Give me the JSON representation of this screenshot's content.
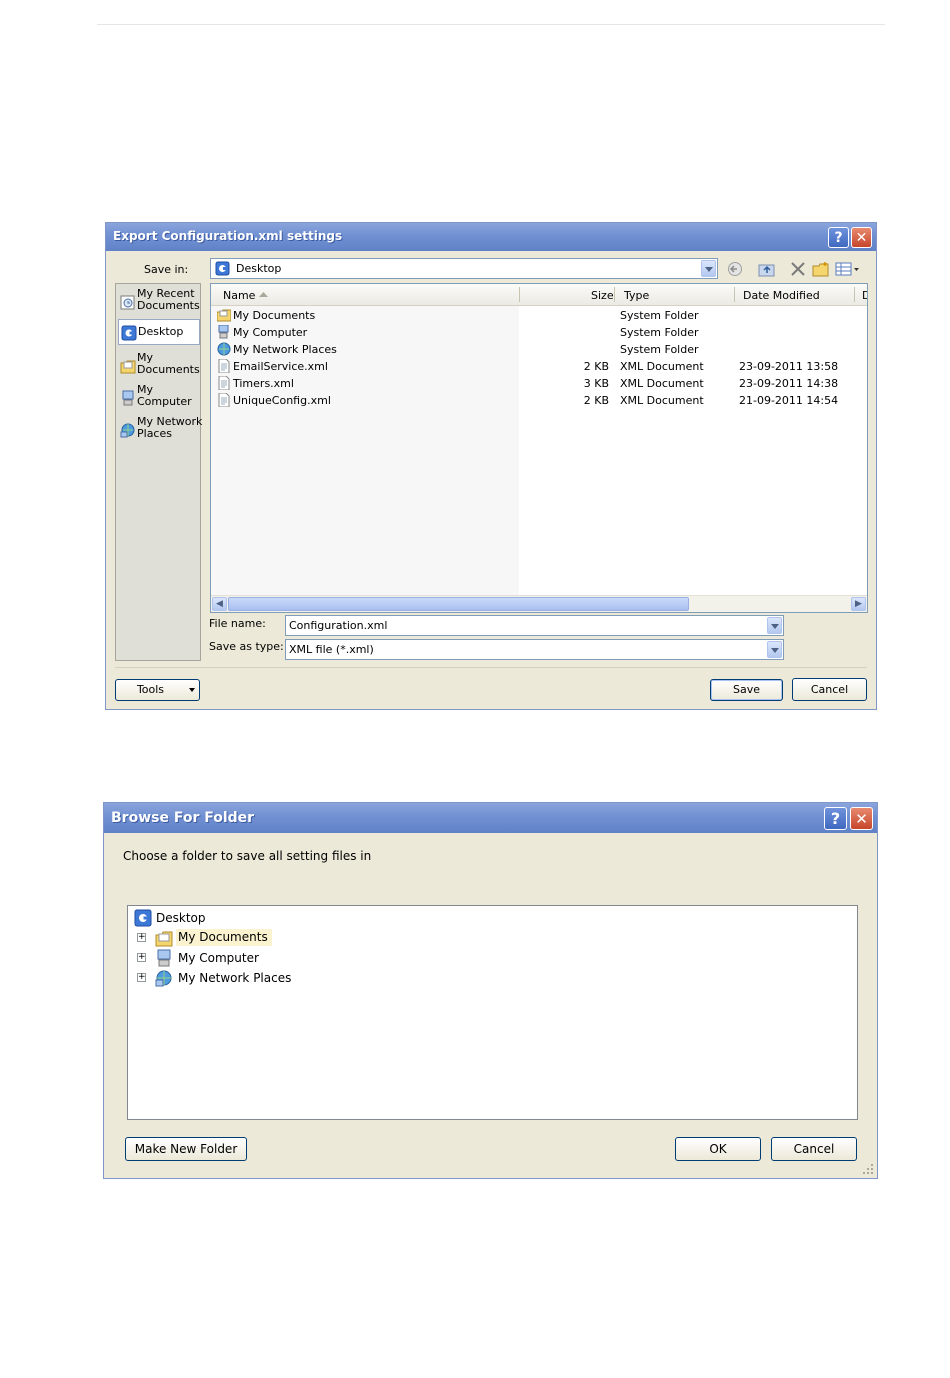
{
  "save_dialog": {
    "title": "Export Configuration.xml settings",
    "help_glyph": "?",
    "close_glyph": "✕",
    "save_in_label": "Save in:",
    "save_in_value": "Desktop",
    "places": [
      {
        "label_line1": "My Recent",
        "label_line2": "Documents",
        "icon": "recent-documents-icon"
      },
      {
        "label_line1": "Desktop",
        "label_line2": "",
        "icon": "desktop-icon"
      },
      {
        "label_line1": "My",
        "label_line2": "Documents",
        "icon": "my-documents-icon"
      },
      {
        "label_line1": "My",
        "label_line2": "Computer",
        "icon": "my-computer-icon"
      },
      {
        "label_line1": "My Network",
        "label_line2": "Places",
        "icon": "network-places-icon"
      }
    ],
    "columns": {
      "name": "Name",
      "size": "Size",
      "type": "Type",
      "date": "Date Modified",
      "extra": "D"
    },
    "files": [
      {
        "name": "My Documents",
        "size": "",
        "type": "System Folder",
        "date": "",
        "icon": "folder-icon"
      },
      {
        "name": "My Computer",
        "size": "",
        "type": "System Folder",
        "date": "",
        "icon": "computer-icon"
      },
      {
        "name": "My Network Places",
        "size": "",
        "type": "System Folder",
        "date": "",
        "icon": "network-icon"
      },
      {
        "name": "EmailService.xml",
        "size": "2 KB",
        "type": "XML Document",
        "date": "23-09-2011 13:58",
        "icon": "xml-file-icon"
      },
      {
        "name": "Timers.xml",
        "size": "3 KB",
        "type": "XML Document",
        "date": "23-09-2011 14:38",
        "icon": "xml-file-icon"
      },
      {
        "name": "UniqueConfig.xml",
        "size": "2 KB",
        "type": "XML Document",
        "date": "21-09-2011 14:54",
        "icon": "xml-file-icon"
      }
    ],
    "file_name_label": "File name:",
    "file_name_value": "Configuration.xml",
    "save_as_type_label": "Save as type:",
    "save_as_type_value": "XML file (*.xml)",
    "tools_label": "Tools",
    "save_label": "Save",
    "cancel_label": "Cancel"
  },
  "browse_dialog": {
    "title": "Browse For Folder",
    "help_glyph": "?",
    "close_glyph": "✕",
    "instruction": "Choose a folder to save all setting files in",
    "tree": {
      "root": "Desktop",
      "children": [
        "My Documents",
        "My Computer",
        "My Network Places"
      ],
      "selected": "My Documents"
    },
    "make_new_folder_label": "Make New Folder",
    "ok_label": "OK",
    "cancel_label": "Cancel"
  },
  "colors": {
    "title_bar": "#7090d2",
    "dialog_bg": "#ece9d8",
    "selection_bg": "#fbf3cf"
  }
}
